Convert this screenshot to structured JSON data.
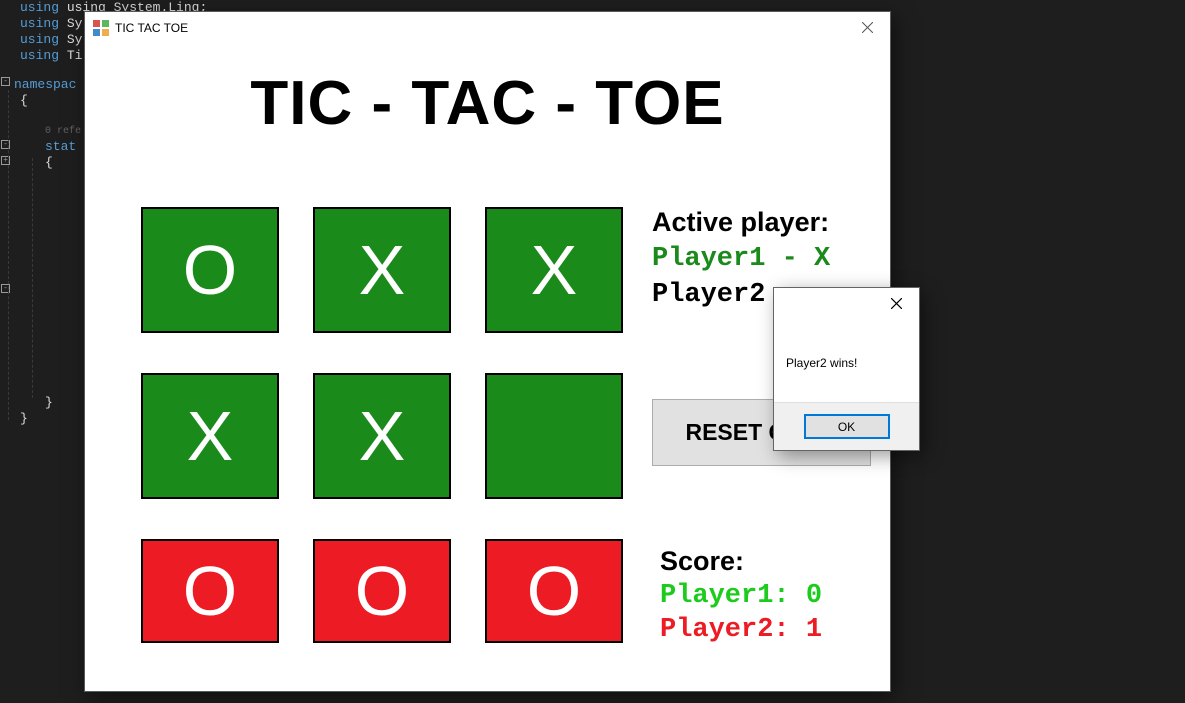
{
  "editor": {
    "lines": {
      "l1": "using System.Linq;",
      "l2": "using Sy",
      "l3": "using Sy",
      "l4": "using Ti",
      "ns": "namespac",
      "brace_o": "{",
      "ref": "0 refe",
      "stat": "stat",
      "brace_o2": "{",
      "brace_c2": "}",
      "brace_c": "}"
    }
  },
  "window": {
    "title": "TIC TAC TOE",
    "game_title": "TIC - TAC - TOE",
    "close_icon": "✕"
  },
  "board": {
    "cells": [
      {
        "value": "O",
        "color": "green"
      },
      {
        "value": "X",
        "color": "green"
      },
      {
        "value": "X",
        "color": "green"
      },
      {
        "value": "X",
        "color": "green"
      },
      {
        "value": "X",
        "color": "green"
      },
      {
        "value": "",
        "color": "green"
      },
      {
        "value": "O",
        "color": "red"
      },
      {
        "value": "O",
        "color": "red"
      },
      {
        "value": "O",
        "color": "red"
      }
    ]
  },
  "panel": {
    "active_label": "Active player:",
    "player1": "Player1 - X",
    "player2": "Player2",
    "reset_label": "RESET GAME"
  },
  "score": {
    "label": "Score:",
    "p1": "Player1:  0",
    "p2": "Player2:  1"
  },
  "dialog": {
    "message": "Player2 wins!",
    "ok": "OK"
  }
}
